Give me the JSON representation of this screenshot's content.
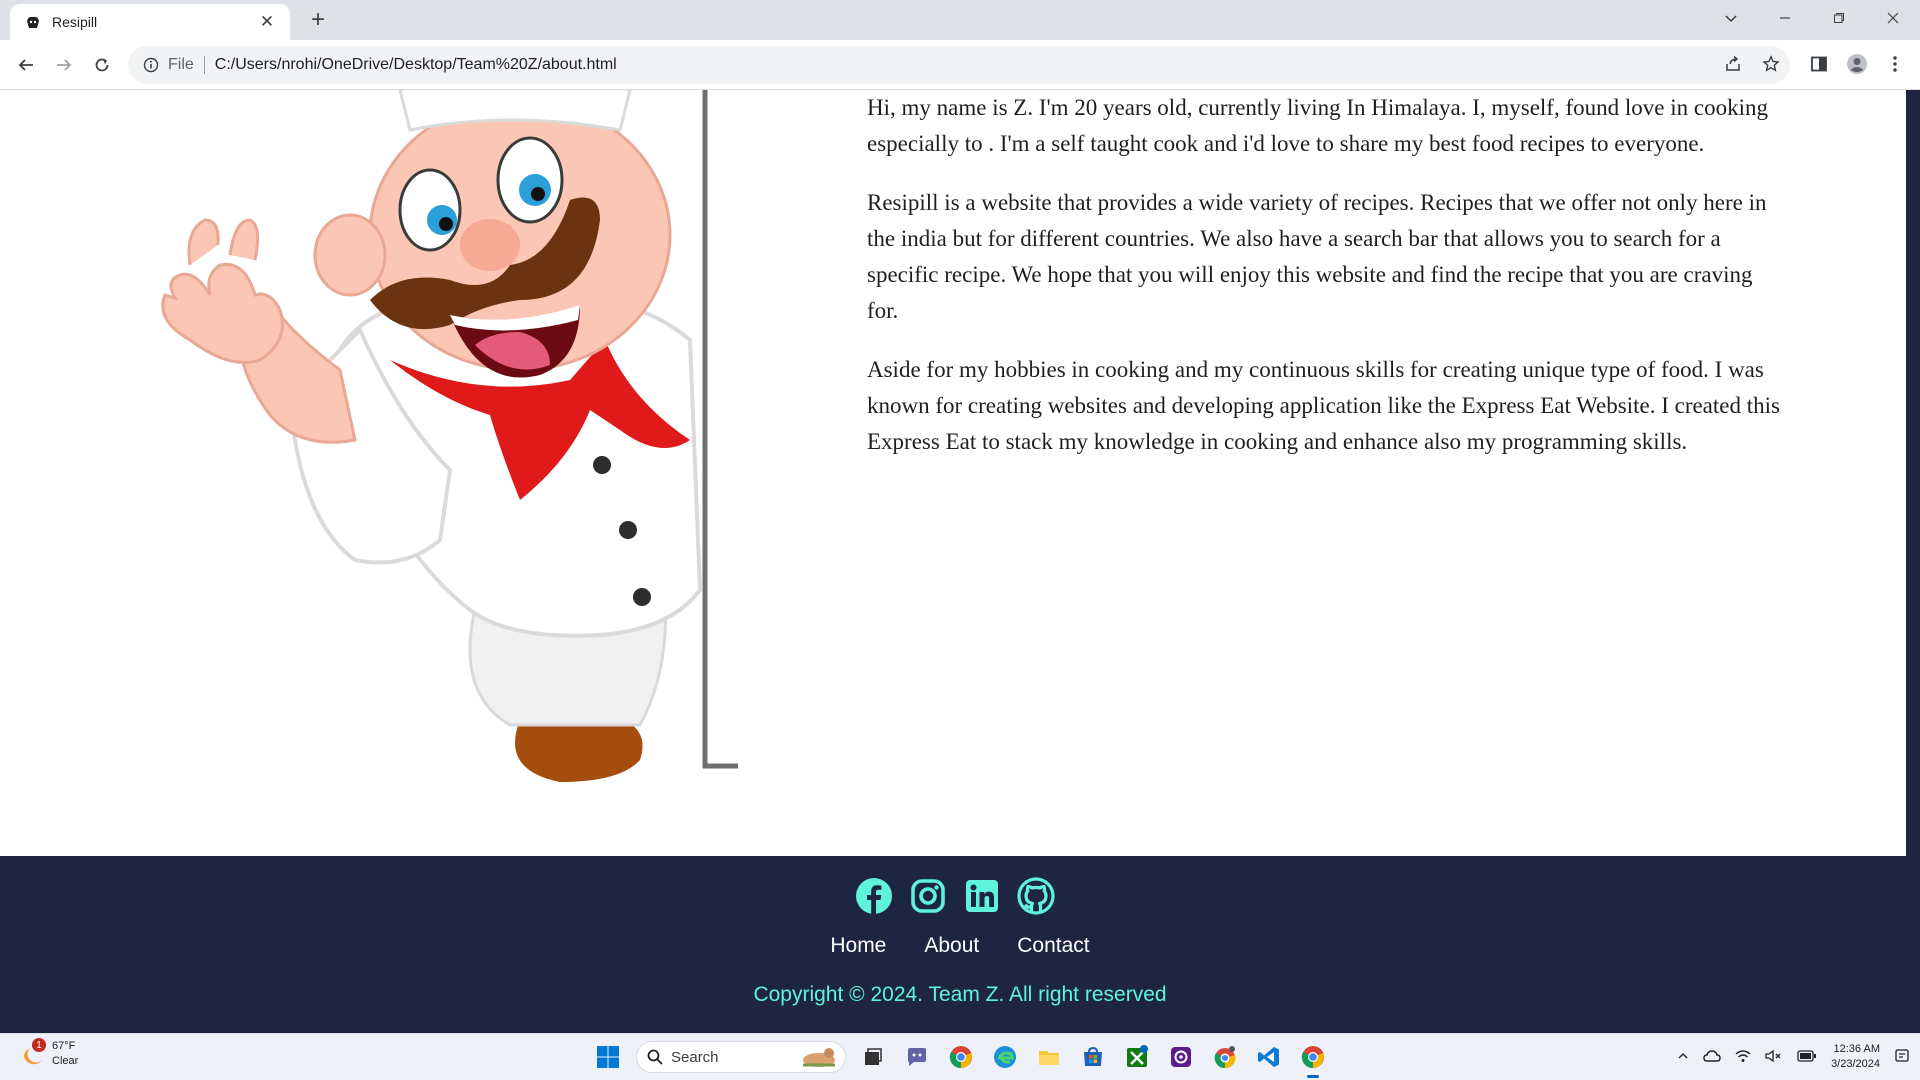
{
  "browser": {
    "tab_title": "Resipill",
    "file_label": "File",
    "url": "C:/Users/nrohi/OneDrive/Desktop/Team%20Z/about.html"
  },
  "about": {
    "paragraphs": [
      "Hi, my name is Z. I'm 20 years old, currently living In Himalaya. I, myself, found love in cooking especially to . I'm a self taught cook and i'd love to share my best food recipes to everyone.",
      "Resipill is a website that provides a wide variety of recipes. Recipes that we offer not only here in the india but for different countries. We also have a search bar that allows you to search for a specific recipe. We hope that you will enjoy this website and find the recipe that you are craving for.",
      "Aside for my hobbies in cooking and my continuous skills for creating unique type of food. I was known for creating websites and developing application like the Express Eat Website. I created this Express Eat to stack my knowledge in cooking and enhance also my programming skills."
    ]
  },
  "footer": {
    "social_icons": [
      "facebook-icon",
      "instagram-icon",
      "linkedin-icon",
      "github-icon"
    ],
    "nav": [
      "Home",
      "About",
      "Contact"
    ],
    "copyright": "Copyright © 2024. Team Z. All right reserved",
    "accent_color": "#5ff4d9",
    "background_color": "#1e2540"
  },
  "taskbar": {
    "weather_badge": "1",
    "temperature": "67°F",
    "condition": "Clear",
    "search_label": "Search",
    "time": "12:36 AM",
    "date": "3/23/2024"
  }
}
